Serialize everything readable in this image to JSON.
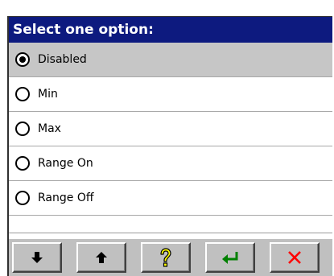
{
  "dialog": {
    "title": "Select one option:"
  },
  "options": [
    {
      "label": "Disabled",
      "selected": true
    },
    {
      "label": "Min",
      "selected": false
    },
    {
      "label": "Max",
      "selected": false
    },
    {
      "label": "Range On",
      "selected": false
    },
    {
      "label": "Range Off",
      "selected": false
    }
  ],
  "toolbar": {
    "buttons": [
      {
        "icon": "arrow-down-icon",
        "color": "#000000"
      },
      {
        "icon": "arrow-up-icon",
        "color": "#000000"
      },
      {
        "icon": "help-icon",
        "color": "#ffff00"
      },
      {
        "icon": "enter-icon",
        "color": "#008000"
      },
      {
        "icon": "close-icon",
        "color": "#ff0000"
      }
    ]
  },
  "colors": {
    "title_bar": "#0d1a7f",
    "selected_row": "#c6c6c6",
    "toolbar": "#c0c0c0"
  }
}
